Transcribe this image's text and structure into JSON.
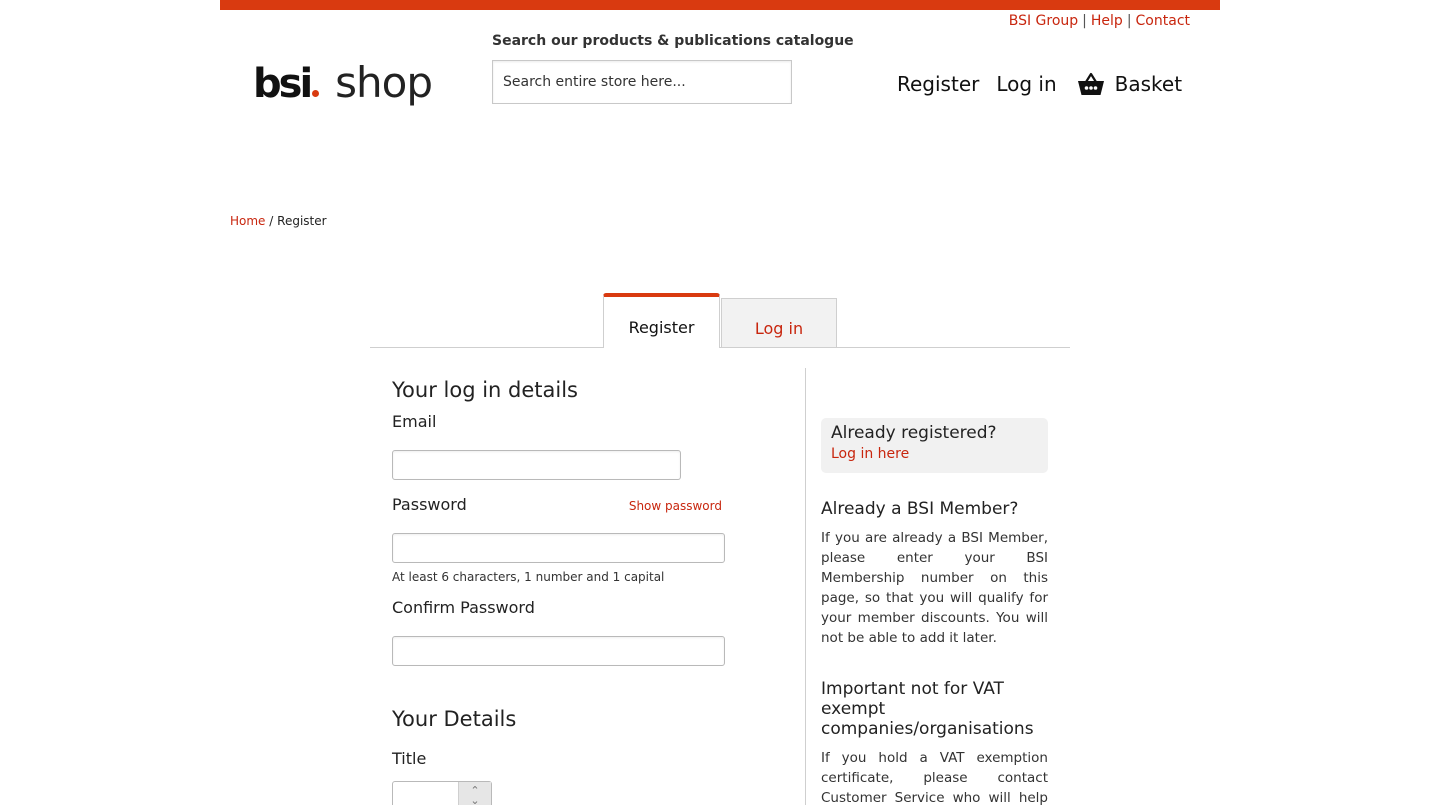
{
  "header": {
    "util_links": [
      "BSI Group",
      "Help",
      "Contact"
    ],
    "logo_brand": "bsi",
    "logo_product": "shop",
    "search_label": "Search our products & publications catalogue",
    "search_placeholder": "Search entire store here...",
    "nav": {
      "register": "Register",
      "login": "Log in",
      "basket": "Basket"
    }
  },
  "breadcrumb": {
    "home": "Home",
    "separator": "/",
    "current": "Register"
  },
  "tabs": {
    "register": "Register",
    "login": "Log in"
  },
  "form": {
    "login_details_heading": "Your log in details",
    "email_label": "Email",
    "email_value": "",
    "password_label": "Password",
    "show_password": "Show password",
    "password_value": "",
    "password_hint": "At least 6 characters, 1 number and 1 capital",
    "confirm_password_label": "Confirm Password",
    "confirm_password_value": "",
    "details_heading": "Your Details",
    "title_label": "Title",
    "title_value": ""
  },
  "sidebar": {
    "registered_title": "Already registered?",
    "registered_link": "Log in here",
    "member_heading": "Already a BSI Member?",
    "member_text": "If you are already a BSI Member, please enter your BSI Membership number on this page, so that you will qualify for your member discounts. You will not be able to add it later.",
    "vat_heading": "Important not for VAT exempt companies/organisations",
    "vat_text": "If you hold a VAT exemption certificate, please contact Customer Service who will help you to process"
  },
  "colors": {
    "accent": "#d93a10",
    "link": "#c8260e"
  }
}
